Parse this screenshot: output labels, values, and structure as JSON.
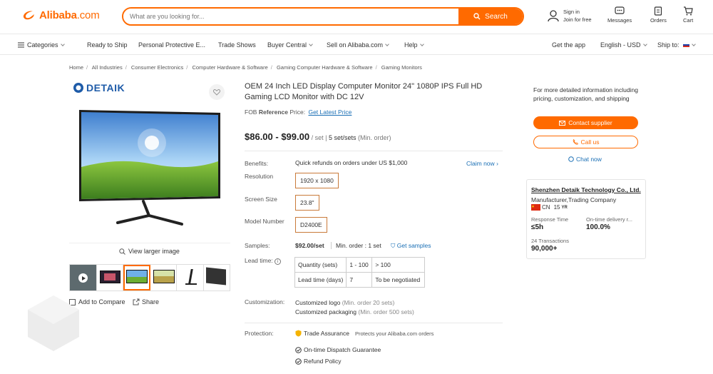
{
  "header": {
    "logo_text": "Alibaba",
    "logo_suffix": ".com",
    "search_placeholder": "What are you looking for...",
    "search_button": "Search",
    "sign_in": "Sign in",
    "join_free": "Join for free",
    "messages": "Messages",
    "orders": "Orders",
    "cart": "Cart"
  },
  "nav": {
    "categories": "Categories",
    "items": [
      "Ready to Ship",
      "Personal Protective E...",
      "Trade Shows",
      "Buyer Central",
      "Sell on Alibaba.com",
      "Help"
    ],
    "get_app": "Get the app",
    "language": "English - USD",
    "ship_to": "Ship to:"
  },
  "breadcrumb": [
    "Home",
    "All Industries",
    "Consumer Electronics",
    "Computer Hardware & Software",
    "Gaming Computer Hardware & Software",
    "Gaming Monitors"
  ],
  "gallery": {
    "brand": "DETAIK",
    "view_larger": "View larger image",
    "add_compare": "Add to Compare",
    "share": "Share"
  },
  "product": {
    "title": "OEM 24 Inch LED Display Computer Monitor 24\" 1080P IPS Full HD Gaming LCD Monitor with DC 12V",
    "fob_prefix": "FOB",
    "fob_bold": "Reference",
    "fob_suffix": "Price:",
    "fob_link": "Get Latest Price",
    "price_range": "$86.00 - $99.00",
    "price_unit": "/ set",
    "moq": "5 set/sets",
    "moq_note": "(Min. order)",
    "benefits_label": "Benefits:",
    "benefits_text": "Quick refunds on orders under US $1,000",
    "claim_now": "Claim now",
    "resolution_label": "Resolution",
    "resolution_value": "1920 x 1080",
    "screen_label": "Screen Size",
    "screen_value": "23.8\"",
    "model_label": "Model Number",
    "model_value": "D2400E",
    "samples_label": "Samples:",
    "samples_price": "$92.00/set",
    "samples_min": "Min. order : 1 set",
    "get_samples": "Get samples",
    "lead_label": "Lead time:",
    "lead_table": {
      "row1": [
        "Quantity (sets)",
        "1 - 100",
        "> 100"
      ],
      "row2": [
        "Lead time (days)",
        "7",
        "To be negotiated"
      ]
    },
    "custom_label": "Customization:",
    "custom_logo": "Customized logo",
    "custom_logo_note": "(Min. order 20 sets)",
    "custom_pack": "Customized packaging",
    "custom_pack_note": "(Min. order 500 sets)",
    "protection_label": "Protection:",
    "trade_assurance": "Trade Assurance",
    "trade_note": "Protects your Alibaba.com orders",
    "dispatch": "On-time Dispatch Guarantee",
    "refund": "Refund Policy"
  },
  "supplier": {
    "info_text": "For more detailed information including pricing, customization, and shipping",
    "contact": "Contact supplier",
    "call": "Call us",
    "chat": "Chat now",
    "company": "Shenzhen Detaik Technology Co., Ltd.",
    "type": "Manufacturer,Trading Company",
    "country": "CN",
    "years": "15",
    "years_unit": "YR",
    "response_label": "Response Time",
    "response_value": "≤5h",
    "ontime_label": "On-time delivery r...",
    "ontime_value": "100.0%",
    "transactions_label": "24 Transactions",
    "transactions_value": "90,000+"
  },
  "colors": {
    "accent": "#ff6a00"
  }
}
